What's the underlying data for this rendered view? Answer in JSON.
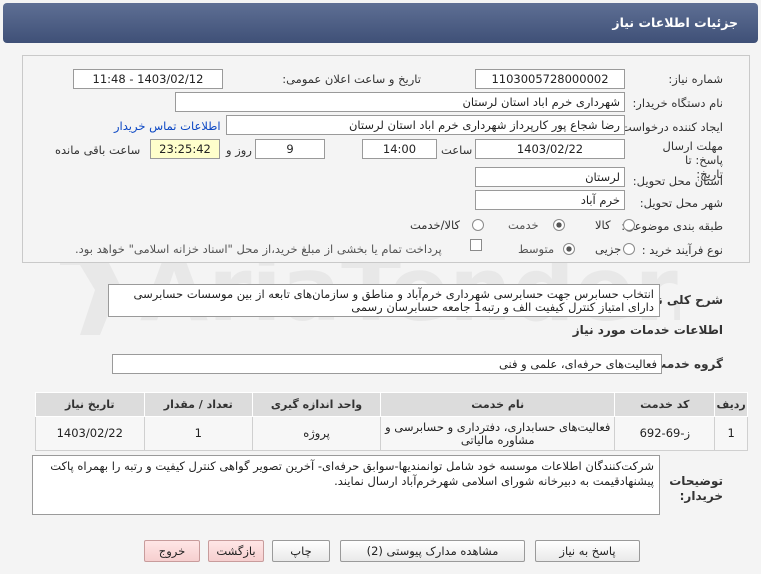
{
  "header": {
    "title": "جزئیات اطلاعات نیاز"
  },
  "form": {
    "need_number_label": "شماره نیاز:",
    "need_number": "1103005728000002",
    "announce_label": "تاریخ و ساعت اعلان عمومی:",
    "announce_value": "1403/02/12 - 11:48",
    "buyer_org_label": "نام دستگاه خریدار:",
    "buyer_org": "شهرداری خرم اباد استان لرستان",
    "requester_label": "ایجاد کننده درخواست:",
    "requester": "رضا شجاع پور کارپرداز شهرداری خرم اباد استان لرستان",
    "contact_link": "اطلاعات تماس خریدار",
    "deadline_label": "مهلت ارسال پاسخ: تا تاریخ:",
    "deadline_date": "1403/02/22",
    "time_label": "ساعت",
    "deadline_time": "14:00",
    "days_value": "9",
    "days_label": "روز و",
    "remaining_time": "23:25:42",
    "remaining_label": "ساعت باقی مانده",
    "province_label": "استان محل تحویل:",
    "province": "لرستان",
    "city_label": "شهر محل تحویل:",
    "city": "خرم آباد",
    "category_label": "طبقه بندی موضوعی:",
    "category_options": [
      "کالا",
      "خدمت",
      "کالا/خدمت"
    ],
    "category_selected": "خدمت",
    "process_label": "نوع فرآیند خرید :",
    "process_options": [
      "جزیی",
      "متوسط"
    ],
    "process_selected": "متوسط",
    "payment_note": "پرداخت تمام یا بخشی از مبلغ خرید،از محل \"اسناد خزانه اسلامی\" خواهد بود."
  },
  "summary": {
    "label": "شرح کلی نیاز:",
    "text": "انتخاب حسابرس جهت حسابرسی شهرداری خرم‌آباد و مناطق و سازمان‌های تابعه از بین موسسات حسابرسی دارای امتیاز کنترل کیفیت الف و رتبه1 جامعه حسابرسان رسمی"
  },
  "services": {
    "section_title": "اطلاعات خدمات مورد نیاز",
    "group_label": "گروه خدمت:",
    "group_value": "فعالیت‌های حرفه‌ای، علمی و فنی",
    "columns": [
      "ردیف",
      "کد خدمت",
      "نام خدمت",
      "واحد اندازه گیری",
      "تعداد / مقدار",
      "تاریخ نیاز"
    ],
    "rows": [
      {
        "row": "1",
        "code": "ز-69-692",
        "name": "فعالیت‌های حسابداری، دفترداری و حسابرسی و مشاوره مالیاتی",
        "unit": "پروژه",
        "qty": "1",
        "date": "1403/02/22"
      }
    ]
  },
  "buyer_notes": {
    "label": "توضیحات خریدار:",
    "text": "شرکت‌کنندگان اطلاعات موسسه خود شامل توانمندیها-سوابق حرفه‌ای- آخرین تصویر گواهی کنترل کیفیت و رتبه را بهمراه پاکت پیشنهادقیمت به دبیرخانه شورای اسلامی شهرخرم‌آباد ارسال نمایند."
  },
  "buttons": {
    "respond": "پاسخ به نیاز",
    "view_docs": "مشاهده مدارک پیوستی (2)",
    "print": "چاپ",
    "back": "بازگشت",
    "exit": "خروج"
  },
  "watermark": "AriaTender.net",
  "colors": {
    "header_bg": "#4b5b82",
    "link": "#0b47c4",
    "red_button": "#f6cfcf"
  }
}
